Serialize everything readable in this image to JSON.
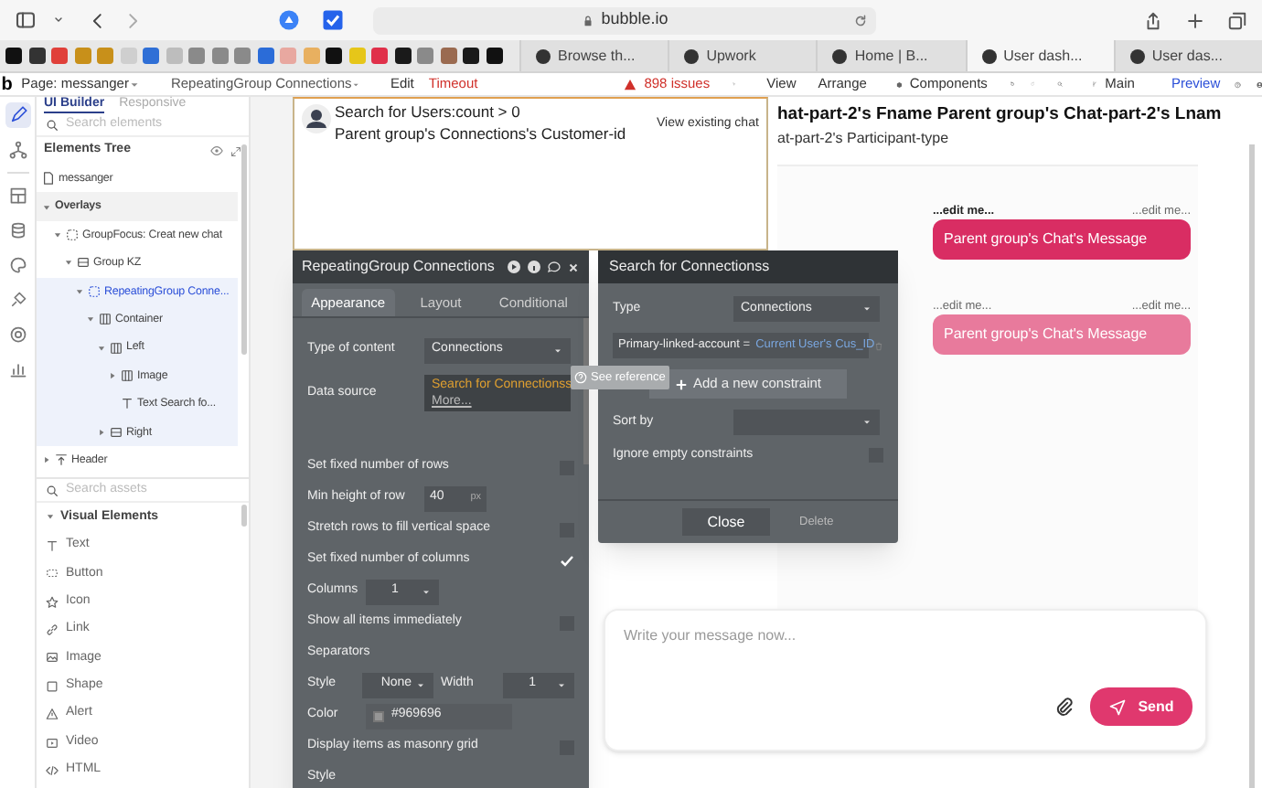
{
  "browser": {
    "address": "bubble.io",
    "bookmarks": [
      {
        "color": "#111111"
      },
      {
        "color": "#333333"
      },
      {
        "color": "#e0403a"
      },
      {
        "color": "#c8901a"
      },
      {
        "color": "#c8901a"
      },
      {
        "color": "#cfcfcf"
      },
      {
        "color": "#2f6fd6"
      },
      {
        "color": "#bdbdbd"
      },
      {
        "color": "#8a8a8a"
      },
      {
        "color": "#8a8a8a"
      },
      {
        "color": "#8a8a8a"
      },
      {
        "color": "#2b6cd8"
      },
      {
        "color": "#e8a8a0"
      },
      {
        "color": "#e8b060"
      },
      {
        "color": "#111111"
      },
      {
        "color": "#e6c619"
      },
      {
        "color": "#e0304a"
      },
      {
        "color": "#1a1a1a"
      },
      {
        "color": "#8a8a8a"
      },
      {
        "color": "#9a6a50"
      },
      {
        "color": "#1a1a1a"
      },
      {
        "color": "#111111"
      }
    ],
    "tabs": [
      {
        "label": "Browse th...",
        "selected": false
      },
      {
        "label": "Upwork",
        "selected": false
      },
      {
        "label": "Home | B...",
        "selected": false
      },
      {
        "label": "User dash...",
        "selected": true
      },
      {
        "label": "User das...",
        "selected": false
      }
    ]
  },
  "toolbar": {
    "logo": "b",
    "page": "Page: messanger",
    "element": "RepeatingGroup Connections",
    "edit": "Edit",
    "timeout": "Timeout",
    "issues": "898 issues",
    "view": "View",
    "arrange": "Arrange",
    "components": "Components",
    "branch": "Main",
    "preview": "Preview"
  },
  "rail": [
    {
      "kind": "design",
      "selected": true
    },
    {
      "kind": "workflow",
      "selected": false
    },
    {
      "kind": "layout",
      "selected": false
    },
    {
      "kind": "data",
      "selected": false
    },
    {
      "kind": "styles",
      "selected": false
    },
    {
      "kind": "plugins",
      "selected": false
    },
    {
      "kind": "settings",
      "selected": false
    },
    {
      "kind": "logs",
      "selected": false
    }
  ],
  "left_panel": {
    "tabs": [
      {
        "label": "UI Builder",
        "selected": true
      },
      {
        "label": "Responsive",
        "selected": false
      }
    ],
    "search": {
      "placeholder": "Search elements"
    },
    "tree_title": "Elements Tree",
    "tree": [
      {
        "label": "messanger",
        "kind": "page",
        "selected": false
      },
      {
        "label": "Overlays",
        "kind": "section",
        "expanded": true,
        "selected": false,
        "children": [
          {
            "label": "GroupFocus: Creat new chat",
            "kind": "focus",
            "expanded": true,
            "selected": false,
            "children": [
              {
                "label": "Group KZ",
                "kind": "group",
                "expanded": true,
                "selected": false,
                "children": [
                  {
                    "label": "RepeatingGroup Conne...",
                    "kind": "focus",
                    "expanded": true,
                    "selected": true,
                    "children": [
                      {
                        "label": "Container",
                        "kind": "columns",
                        "expanded": true,
                        "selected": false,
                        "children": [
                          {
                            "label": "Left",
                            "kind": "columns",
                            "expanded": true,
                            "selected": false,
                            "children": [
                              {
                                "label": "Image",
                                "kind": "columns",
                                "expanded": false,
                                "selected": false
                              },
                              {
                                "label": "Text Search fo...",
                                "kind": "text",
                                "selected": false
                              }
                            ]
                          },
                          {
                            "label": "Right",
                            "kind": "group",
                            "expanded": false,
                            "selected": false
                          }
                        ]
                      }
                    ]
                  }
                ]
              }
            ]
          }
        ]
      },
      {
        "label": "Header",
        "kind": "header",
        "expanded": false,
        "selected": false
      }
    ],
    "asset_search": {
      "placeholder": "Search assets"
    },
    "asset_group": {
      "label": "Visual Elements",
      "expanded": true
    },
    "assets": [
      {
        "label": "Text",
        "kind": "text"
      },
      {
        "label": "Button",
        "kind": "button"
      },
      {
        "label": "Icon",
        "kind": "star"
      },
      {
        "label": "Link",
        "kind": "link"
      },
      {
        "label": "Image",
        "kind": "image"
      },
      {
        "label": "Shape",
        "kind": "shape"
      },
      {
        "label": "Alert",
        "kind": "alert"
      },
      {
        "label": "Video",
        "kind": "video"
      },
      {
        "label": "HTML",
        "kind": "code"
      }
    ]
  },
  "canvas": {
    "card": {
      "condition": "Search for Users:count > 0",
      "subtitle": "Parent group's Connections's Customer-id",
      "action": "View existing chat"
    },
    "chat_header": {
      "name": "hat-part-2's Fname Parent group's Chat-part-2's Lnam",
      "subtitle": "at-part-2's Participant-type"
    },
    "messages": [
      {
        "sender": "...edit me...",
        "time": "...edit me...",
        "text": "Parent group's Chat's Message",
        "faded": false
      },
      {
        "sender": "...edit me...",
        "time": "...edit me...",
        "text": "Parent group's Chat's Message",
        "faded": true
      }
    ],
    "composer": {
      "placeholder": "Write your message now...",
      "send": "Send"
    }
  },
  "property_editor": {
    "title": "RepeatingGroup Connections",
    "tabs": [
      {
        "label": "Appearance",
        "selected": true
      },
      {
        "label": "Layout",
        "selected": false
      },
      {
        "label": "Conditional",
        "selected": false
      }
    ],
    "rows": [
      {
        "kind": "dropdown",
        "label": "Type of content",
        "value": "Connections"
      },
      {
        "kind": "source",
        "label": "Data source",
        "value": "Search for Connectionss",
        "more": "More..."
      },
      {
        "kind": "checkbox",
        "label": "Set fixed number of rows",
        "checked": false
      },
      {
        "kind": "size",
        "label": "Min height of row",
        "value": "40",
        "unit": "px"
      },
      {
        "kind": "checkbox",
        "label": "Stretch rows to fill vertical space",
        "checked": false
      },
      {
        "kind": "checkbox",
        "label": "Set fixed number of columns",
        "checked": true
      },
      {
        "kind": "select",
        "label": "Columns",
        "value": "1"
      },
      {
        "kind": "checkbox",
        "label": "Show all items immediately",
        "checked": false
      },
      {
        "kind": "heading",
        "label": "Separators"
      },
      {
        "kind": "pair",
        "label": "Style",
        "value": "None",
        "label2": "Width",
        "value2": "1"
      },
      {
        "kind": "color",
        "label": "Color",
        "value": "#969696"
      },
      {
        "kind": "checkbox",
        "label": "Display items as masonry grid",
        "checked": false
      },
      {
        "kind": "heading",
        "label": "Style"
      }
    ]
  },
  "tooltip": "See reference",
  "search_editor": {
    "title": "Search for Connectionss",
    "type_label": "Type",
    "type_value": "Connections",
    "constraint": {
      "field": "Primary-linked-account =",
      "value": "Current User's Cus_ID"
    },
    "add": "Add a new constraint",
    "sort_label": "Sort by",
    "ignore": {
      "label": "Ignore empty constraints",
      "checked": false
    },
    "close": "Close",
    "delete": "Delete"
  }
}
